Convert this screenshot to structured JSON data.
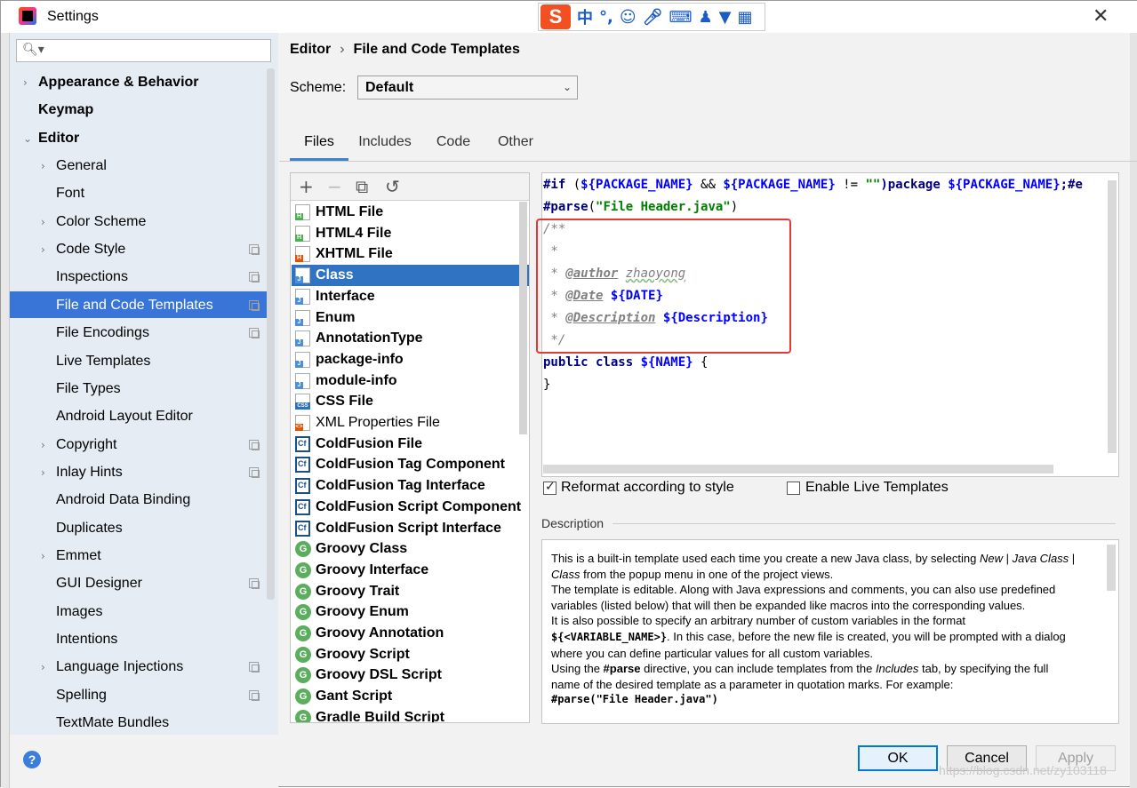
{
  "window": {
    "title": "Settings"
  },
  "ime": {
    "logo": "S",
    "mode_zh": "中",
    "punct": "°,"
  },
  "search": {
    "placeholder": "",
    "icon": "search-icon"
  },
  "sidebar": {
    "items": [
      {
        "label": "Appearance & Behavior",
        "expandable": true,
        "expanded": false
      },
      {
        "label": "Keymap"
      },
      {
        "label": "Editor",
        "expandable": true,
        "expanded": true
      },
      {
        "label": "General",
        "expandable": true
      },
      {
        "label": "Font"
      },
      {
        "label": "Color Scheme",
        "expandable": true
      },
      {
        "label": "Code Style",
        "expandable": true,
        "copy": true
      },
      {
        "label": "Inspections",
        "copy": true
      },
      {
        "label": "File and Code Templates",
        "copy": true,
        "selected": true
      },
      {
        "label": "File Encodings",
        "copy": true
      },
      {
        "label": "Live Templates"
      },
      {
        "label": "File Types"
      },
      {
        "label": "Android Layout Editor"
      },
      {
        "label": "Copyright",
        "expandable": true,
        "copy": true
      },
      {
        "label": "Inlay Hints",
        "expandable": true,
        "copy": true
      },
      {
        "label": "Android Data Binding"
      },
      {
        "label": "Duplicates"
      },
      {
        "label": "Emmet",
        "expandable": true
      },
      {
        "label": "GUI Designer",
        "copy": true
      },
      {
        "label": "Images"
      },
      {
        "label": "Intentions"
      },
      {
        "label": "Language Injections",
        "expandable": true,
        "copy": true
      },
      {
        "label": "Spelling",
        "copy": true
      },
      {
        "label": "TextMate Bundles"
      }
    ]
  },
  "breadcrumb": {
    "parent": "Editor",
    "separator": "›",
    "current": "File and Code Templates"
  },
  "scheme": {
    "label": "Scheme:",
    "value": "Default"
  },
  "tabs": [
    "Files",
    "Includes",
    "Code",
    "Other"
  ],
  "toolbar": {
    "add": "+",
    "remove": "−",
    "copy": "⧉",
    "reset": "↺"
  },
  "templates": [
    {
      "label": "HTML File",
      "icon": "html"
    },
    {
      "label": "HTML4 File",
      "icon": "html"
    },
    {
      "label": "XHTML File",
      "icon": "xhtml"
    },
    {
      "label": "Class",
      "icon": "java",
      "selected": true
    },
    {
      "label": "Interface",
      "icon": "java"
    },
    {
      "label": "Enum",
      "icon": "java"
    },
    {
      "label": "AnnotationType",
      "icon": "java"
    },
    {
      "label": "package-info",
      "icon": "java"
    },
    {
      "label": "module-info",
      "icon": "java"
    },
    {
      "label": "CSS File",
      "icon": "css"
    },
    {
      "label": "XML Properties File",
      "icon": "xml",
      "plain": true
    },
    {
      "label": "ColdFusion File",
      "icon": "cf"
    },
    {
      "label": "ColdFusion Tag Component",
      "icon": "cf"
    },
    {
      "label": "ColdFusion Tag Interface",
      "icon": "cf"
    },
    {
      "label": "ColdFusion Script Component",
      "icon": "cf"
    },
    {
      "label": "ColdFusion Script Interface",
      "icon": "cf"
    },
    {
      "label": "Groovy Class",
      "icon": "groovy"
    },
    {
      "label": "Groovy Interface",
      "icon": "groovy"
    },
    {
      "label": "Groovy Trait",
      "icon": "groovy"
    },
    {
      "label": "Groovy Enum",
      "icon": "groovy"
    },
    {
      "label": "Groovy Annotation",
      "icon": "groovy"
    },
    {
      "label": "Groovy Script",
      "icon": "groovy"
    },
    {
      "label": "Groovy DSL Script",
      "icon": "groovy"
    },
    {
      "label": "Gant Script",
      "icon": "groovy"
    },
    {
      "label": "Gradle Build Script",
      "icon": "groovy"
    }
  ],
  "editor": {
    "l1_if": "#if",
    "l1_a": " (",
    "l1_v1": "${PACKAGE_NAME}",
    "l1_b": " && ",
    "l1_v2": "${PACKAGE_NAME}",
    "l1_c": " != ",
    "l1_s": "\"\"",
    "l1_d": ")package ",
    "l1_v3": "${PACKAGE_NAME}",
    "l1_e": ";#e",
    "l2_kw": "#parse",
    "l2_a": "(",
    "l2_s": "\"File Header.java\"",
    "l2_b": ")",
    "l3": "/**",
    "l4": " *",
    "l5_pre": " * ",
    "l5_tag": "@author",
    "l5_val": "zhaoyong",
    "l6_pre": " * ",
    "l6_tag": "@Date",
    "l6_var": "${DATE}",
    "l7_pre": " * ",
    "l7_tag": "@Description",
    "l7_var": "${Description}",
    "l8": " */",
    "l9_kw": "public class ",
    "l9_var": "${NAME}",
    "l9_rest": " {",
    "l10": "}"
  },
  "options": {
    "reformat": "Reformat according to style",
    "reformat_checked": true,
    "live": "Enable Live Templates",
    "live_checked": false
  },
  "description": {
    "title": "Description",
    "p1a": "This is a built-in template used each time you create a new Java class, by selecting ",
    "p1i1": "New",
    "p1b": " | ",
    "p1i2": "Java Class",
    "p1c": " | ",
    "p1i3": "Class",
    "p1d": " from the popup menu in one of the project views.",
    "p2": "The template is editable. Along with Java expressions and comments, you can also use predefined variables (listed below) that will then be expanded like macros into the corresponding values.",
    "p3a": "It is also possible to specify an arbitrary number of custom variables in the format ",
    "p3code": "${<VARIABLE_NAME>}",
    "p3b": ". In this case, before the new file is created, you will be prompted with a dialog where you can define particular values for all custom variables.",
    "p4a": "Using the ",
    "p4code": "#parse",
    "p4b": " directive, you can include templates from the ",
    "p4i": "Includes",
    "p4c": " tab, by specifying the full name of the desired template as a parameter in quotation marks. For example:",
    "p5code": "#parse(\"File Header.java\")"
  },
  "buttons": {
    "ok": "OK",
    "cancel": "Cancel",
    "apply": "Apply",
    "help": "?"
  },
  "watermark": "https://blog.csdn.net/zy103118"
}
